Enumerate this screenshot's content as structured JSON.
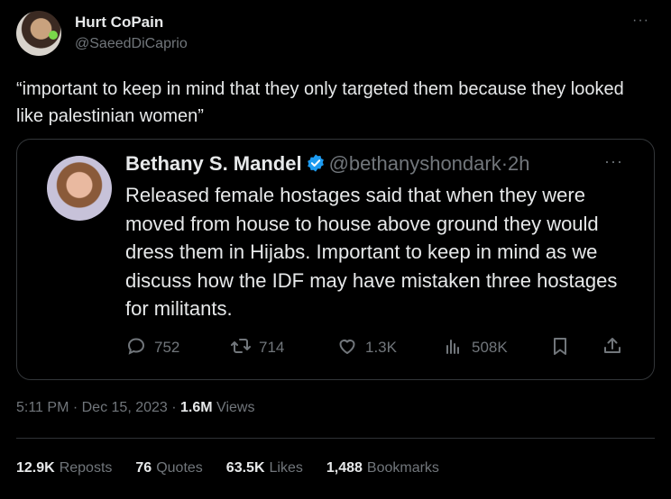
{
  "author": {
    "name": "Hurt CoPain",
    "handle": "@SaeedDiCaprio",
    "more": "···"
  },
  "tweet": {
    "text": "“important to keep in mind that they only targeted them because they looked like palestinian women”",
    "time": "5:11 PM",
    "sep1": " · ",
    "date": "Dec 15, 2023",
    "sep2": " · ",
    "views": "1.6M",
    "views_label": " Views"
  },
  "quoted": {
    "name": "Bethany S. Mandel",
    "handle": "@bethanyshondark",
    "dot": "·",
    "time": "2h",
    "more": "···",
    "verified_color": "#1d9bf0",
    "text": "Released female hostages said that when they were moved from house to house above ground they would dress them in Hijabs.  Important to keep in mind as we discuss how the IDF may have mistaken three hostages for militants.",
    "actions": {
      "replies": "752",
      "retweets": "714",
      "likes": "1.3K",
      "views": "508K"
    }
  },
  "stats": {
    "reposts": "12.9K",
    "reposts_label": "Reposts",
    "quotes": "76",
    "quotes_label": "Quotes",
    "likes": "63.5K",
    "likes_label": "Likes",
    "bookmarks": "1,488",
    "bookmarks_label": "Bookmarks"
  }
}
